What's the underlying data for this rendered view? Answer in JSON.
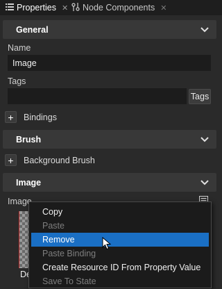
{
  "tabs": [
    {
      "label": "Properties",
      "icon": "list-icon",
      "active": true
    },
    {
      "label": "Node Components",
      "icon": "components-icon",
      "active": false
    }
  ],
  "sections": {
    "general": "General",
    "brush": "Brush",
    "image": "Image"
  },
  "fields": {
    "name_label": "Name",
    "name_value": "Image",
    "tags_label": "Tags",
    "tags_value": "",
    "tags_button": "Tags",
    "bindings_label": "Bindings",
    "background_brush_label": "Background Brush",
    "image_label": "Image",
    "thumbnail_caption": "De"
  },
  "context_menu": {
    "items": [
      {
        "label": "Copy",
        "enabled": true
      },
      {
        "label": "Paste",
        "enabled": false
      },
      {
        "label": "Remove",
        "enabled": true,
        "highlighted": true
      },
      {
        "label": "Paste Binding",
        "enabled": false
      },
      {
        "label": "Create Resource ID From Property Value",
        "enabled": true
      },
      {
        "label": "Save To State",
        "enabled": false
      }
    ]
  },
  "colors": {
    "accent": "#1a6fc4",
    "panel": "#2a2a2a",
    "header": "#383838"
  }
}
